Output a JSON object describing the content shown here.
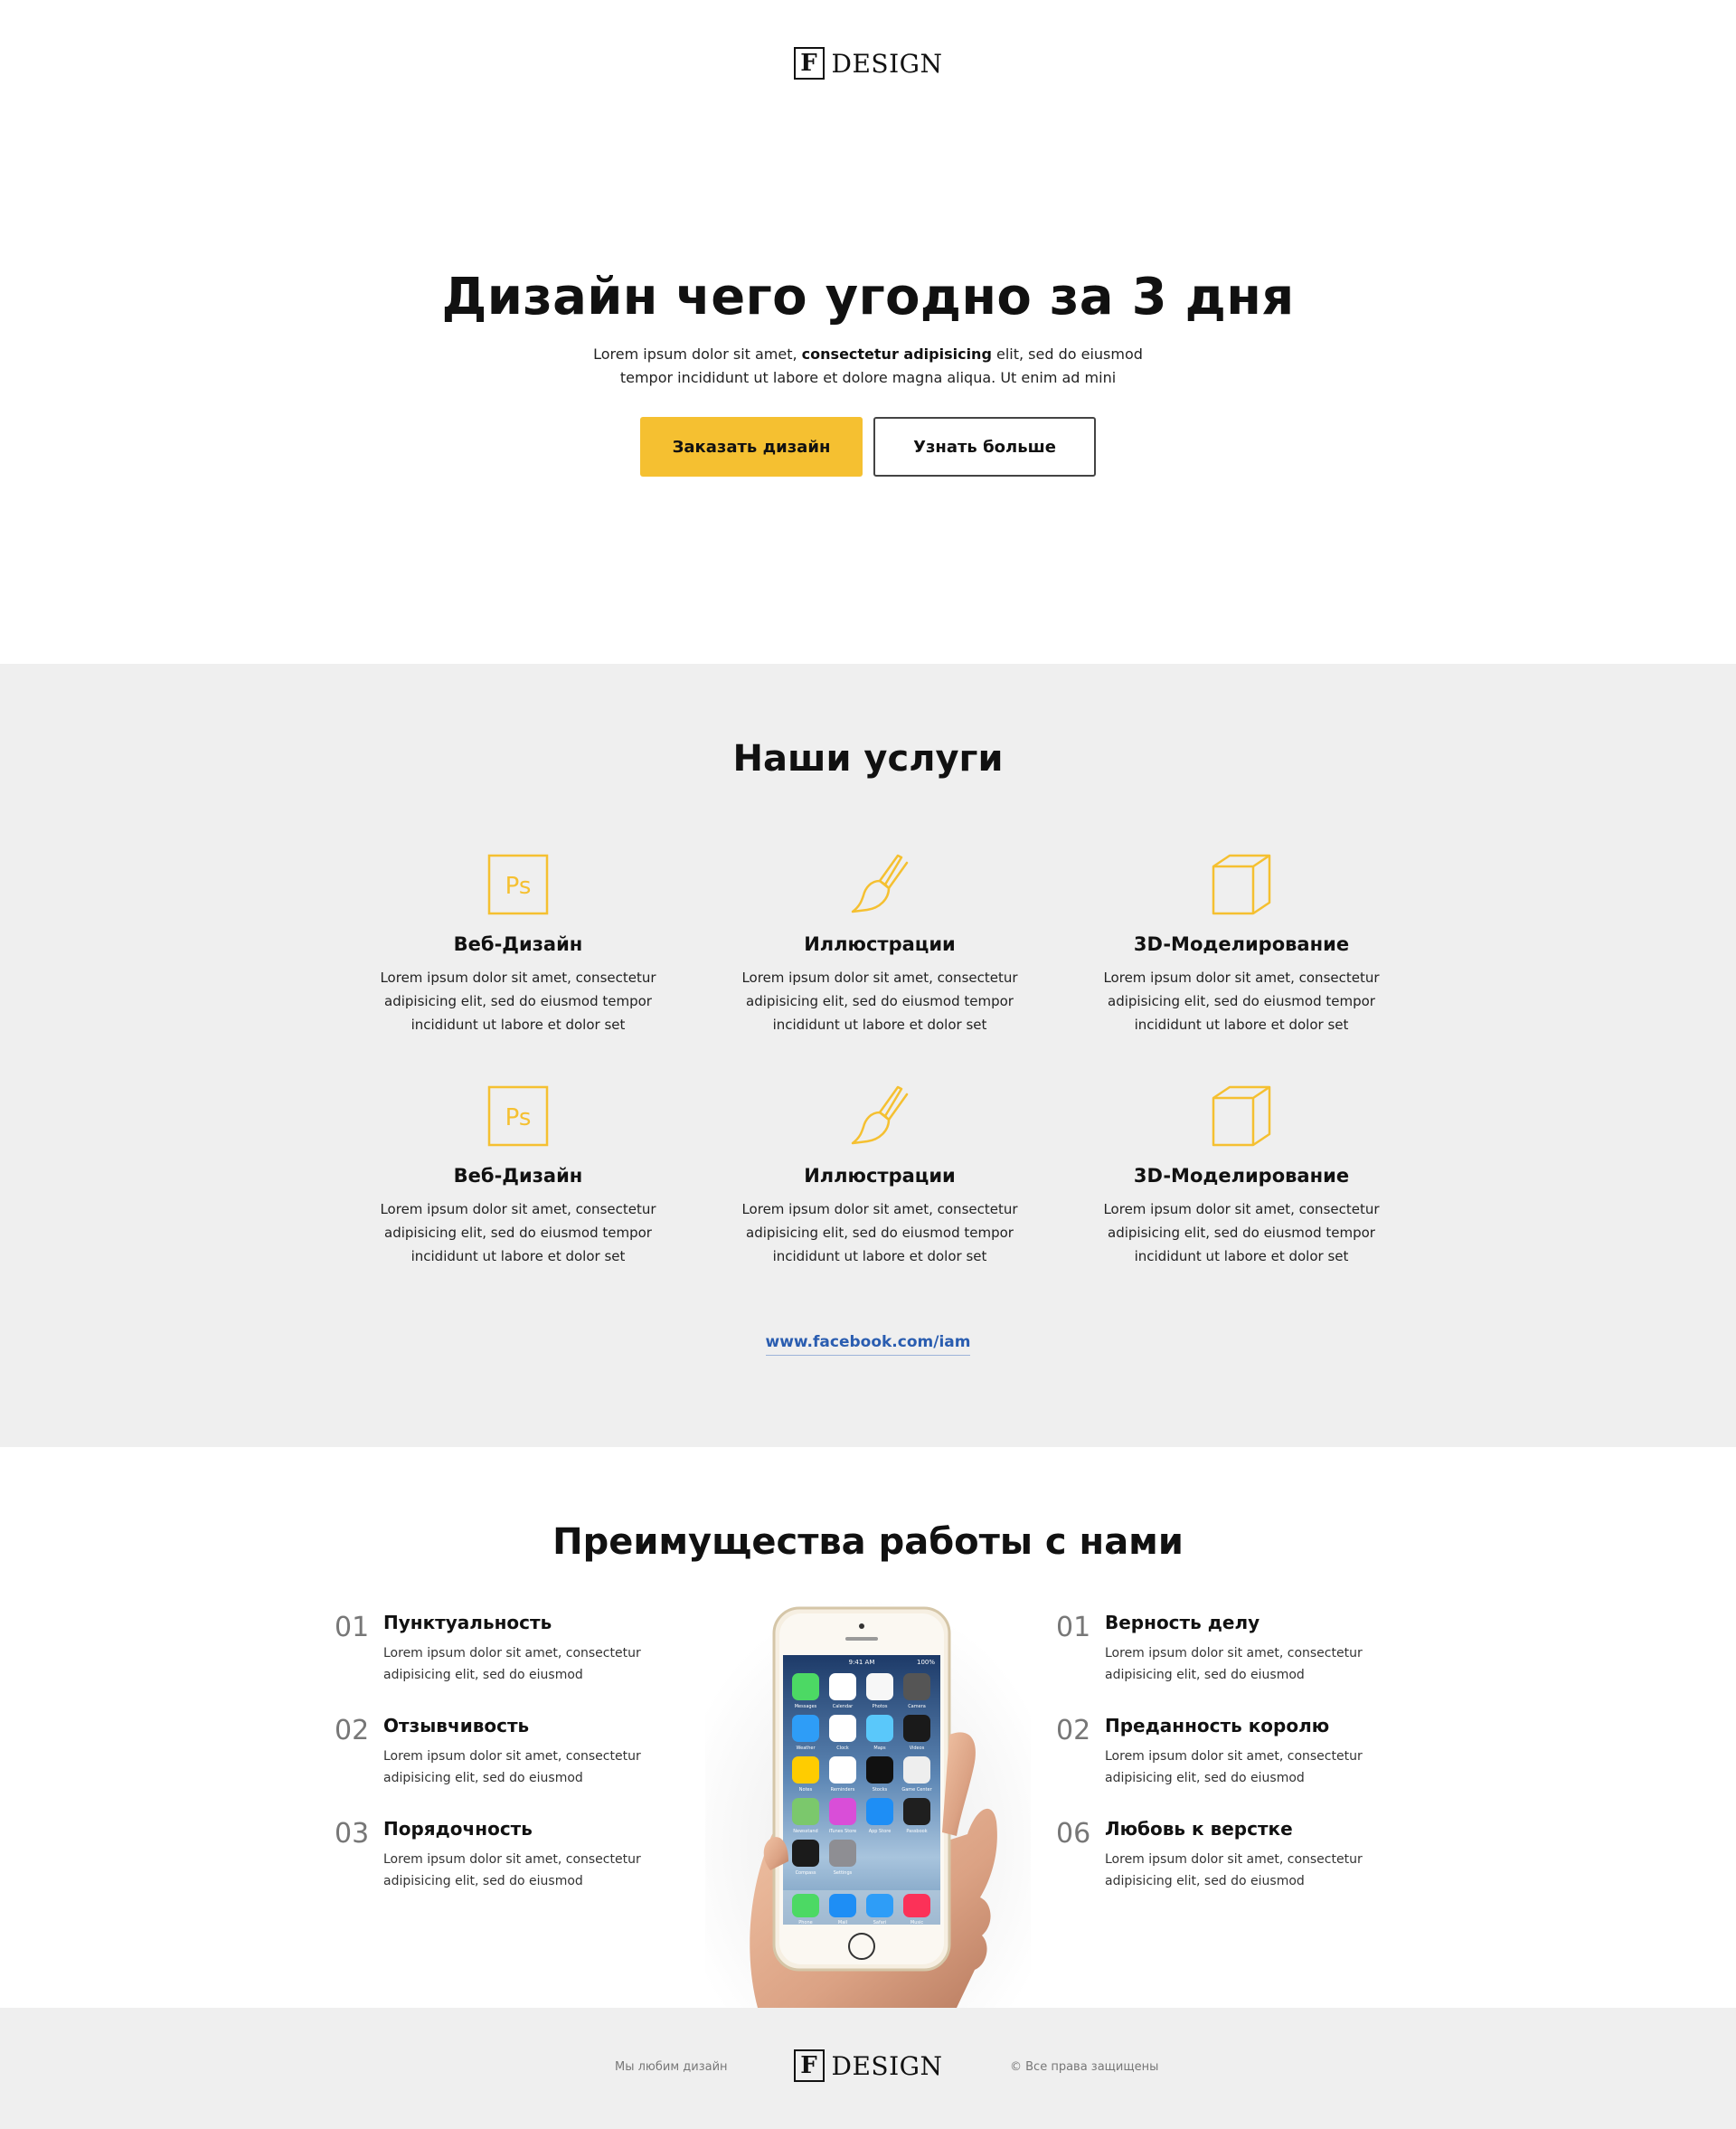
{
  "brand": {
    "mark": "F",
    "name": "DESIGN"
  },
  "colors": {
    "accent": "#f5c031",
    "link": "#2a5db0",
    "gray_bg": "#efefef"
  },
  "hero": {
    "title": "Дизайн чего угодно за 3 дня",
    "text_before": "Lorem ipsum dolor sit amet, ",
    "text_bold": "consectetur adipisicing",
    "text_after": " elit, sed do eiusmod tempor incididunt ut labore et dolore magna aliqua. Ut enim ad mini",
    "primary_button": "Заказать дизайн",
    "secondary_button": "Узнать больше"
  },
  "services": {
    "title": "Наши услуги",
    "items": [
      {
        "icon": "photoshop-icon",
        "title": "Веб-Дизайн",
        "text": "Lorem ipsum dolor sit amet, consectetur adipisicing elit, sed do eiusmod tempor incididunt ut labore et dolor set"
      },
      {
        "icon": "brush-icon",
        "title": "Иллюстрации",
        "text": "Lorem ipsum dolor sit amet, consectetur adipisicing elit, sed do eiusmod tempor incididunt ut labore et dolor set"
      },
      {
        "icon": "cube-icon",
        "title": "3D-Моделирование",
        "text": "Lorem ipsum dolor sit amet, consectetur adipisicing elit, sed do eiusmod tempor incididunt ut labore et dolor set"
      },
      {
        "icon": "photoshop-icon",
        "title": "Веб-Дизайн",
        "text": "Lorem ipsum dolor sit amet, consectetur adipisicing elit, sed do eiusmod tempor incididunt ut labore et dolor set"
      },
      {
        "icon": "brush-icon",
        "title": "Иллюстрации",
        "text": "Lorem ipsum dolor sit amet, consectetur adipisicing elit, sed do eiusmod tempor incididunt ut labore et dolor set"
      },
      {
        "icon": "cube-icon",
        "title": "3D-Моделирование",
        "text": "Lorem ipsum dolor sit amet, consectetur adipisicing elit, sed do eiusmod tempor incididunt ut labore et dolor set"
      }
    ],
    "link": "www.facebook.com/iam"
  },
  "advantages": {
    "title": "Преимущества работы с нами",
    "left": [
      {
        "num": "01",
        "title": "Пунктуальность",
        "text": "Lorem ipsum dolor sit amet, consectetur adipisicing elit, sed do eiusmod"
      },
      {
        "num": "02",
        "title": "Отзывчивость",
        "text": "Lorem ipsum dolor sit amet, consectetur adipisicing elit, sed do eiusmod"
      },
      {
        "num": "03",
        "title": "Порядочность",
        "text": "Lorem ipsum dolor sit amet, consectetur adipisicing elit, sed do eiusmod"
      }
    ],
    "right": [
      {
        "num": "01",
        "title": "Верность делу",
        "text": "Lorem ipsum dolor sit amet, consectetur adipisicing elit, sed do eiusmod"
      },
      {
        "num": "02",
        "title": "Преданность королю",
        "text": "Lorem ipsum dolor sit amet, consectetur adipisicing elit, sed do eiusmod"
      },
      {
        "num": "06",
        "title": "Любовь к верстке",
        "text": "Lorem ipsum dolor sit amet, consectetur adipisicing elit, sed do eiusmod"
      }
    ],
    "phone_time": "9:41 AM",
    "phone_battery": "100%",
    "phone_date_day": "Tuesday",
    "phone_date_num": "10",
    "phone_apps": [
      "Messages",
      "Calendar",
      "Photos",
      "Camera",
      "Weather",
      "Clock",
      "Maps",
      "Videos",
      "Notes",
      "Reminders",
      "Stocks",
      "Game Center",
      "Newsstand",
      "iTunes Store",
      "App Store",
      "Passbook",
      "Compass",
      "Settings"
    ],
    "phone_dock": [
      "Phone",
      "Mail",
      "Safari",
      "Music"
    ]
  },
  "footer": {
    "left": "Мы любим дизайн",
    "right": "© Все права защищены"
  }
}
